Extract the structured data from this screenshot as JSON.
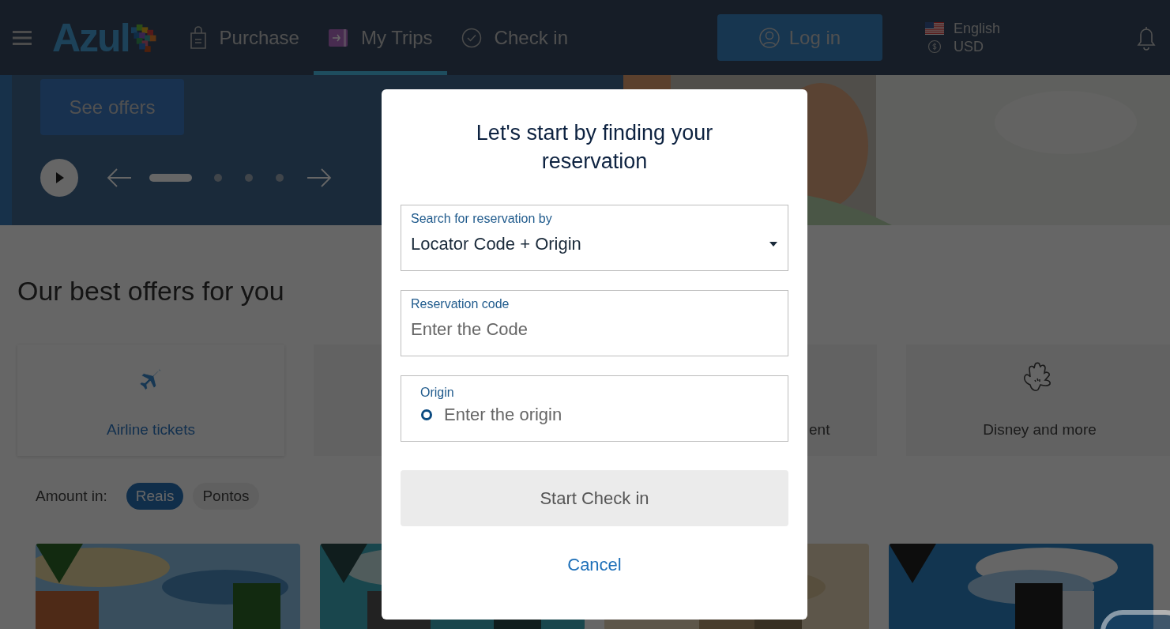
{
  "header": {
    "logo": "Azul",
    "nav": [
      {
        "label": "Purchase",
        "kind": "bag",
        "selected": false
      },
      {
        "label": "My Trips",
        "kind": "ticket",
        "selected": true
      },
      {
        "label": "Check in",
        "kind": "check",
        "selected": false
      }
    ],
    "login": "Log in",
    "language": "English",
    "currency": "USD"
  },
  "hero": {
    "button": "See offers",
    "slides": [
      {
        "selected": true
      },
      {
        "selected": false
      },
      {
        "selected": false
      },
      {
        "selected": false
      }
    ]
  },
  "offers": {
    "title": "Our best offers for you",
    "categories": [
      {
        "kind": "plane",
        "label": "Airline tickets"
      },
      {
        "kind": "plain"
      },
      {
        "kind": "plain",
        "label": "ent"
      },
      {
        "kind": "hand",
        "label": "Disney and more"
      }
    ],
    "amount": {
      "label": "Amount in:",
      "options": [
        {
          "label": "Reais",
          "selected": true
        },
        {
          "label": "Pontos",
          "selected": false
        }
      ]
    }
  },
  "dialog": {
    "title": "Let's start by finding your reservation",
    "fields": [
      {
        "kind": "select",
        "label": "Search for reservation by",
        "value": "Locator Code + Origin"
      },
      {
        "kind": "text",
        "label": "Reservation code",
        "placeholder": "Enter the Code"
      },
      {
        "kind": "origin",
        "label": "Origin",
        "placeholder": "Enter the origin"
      }
    ],
    "submit": {
      "label": "Start Check in",
      "disabled": true
    },
    "cancel": "Cancel"
  }
}
